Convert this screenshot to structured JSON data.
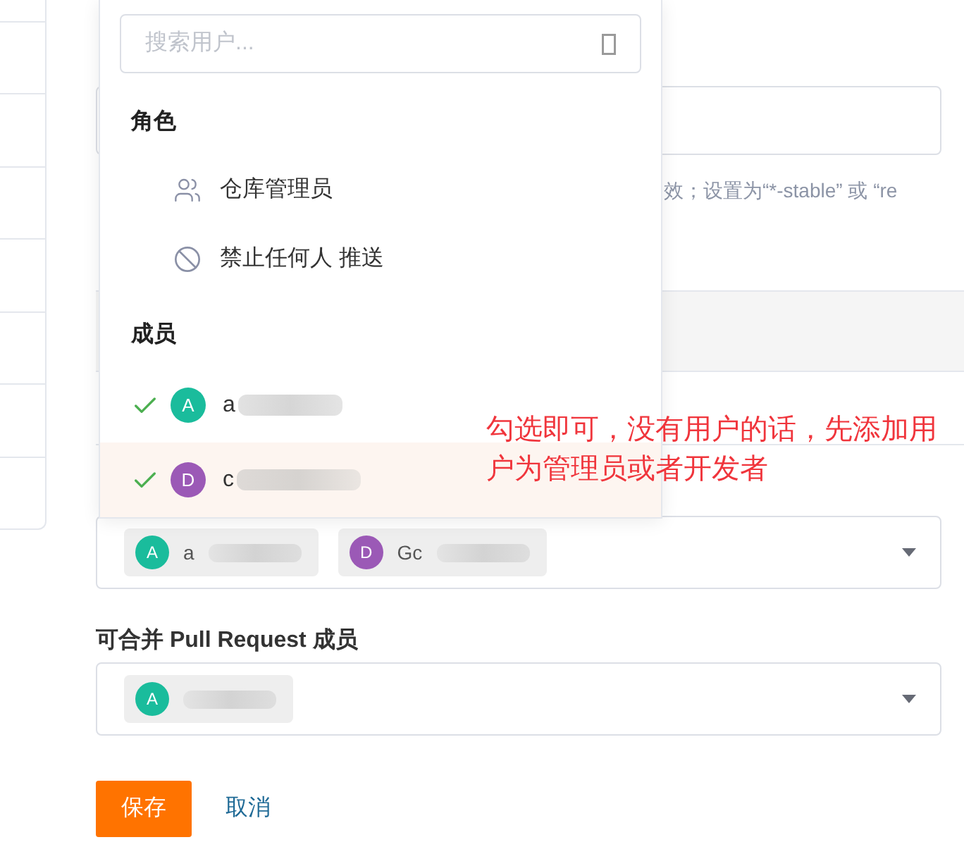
{
  "form": {
    "hint": "效；设置为“*-stable” 或 “re",
    "members_field": {
      "tags": [
        {
          "avatar": "A",
          "color": "#1abc9c",
          "name": "a"
        },
        {
          "avatar": "D",
          "color": "#9b59b6",
          "name": "Gc"
        }
      ]
    },
    "merge_field": {
      "label": "可合并 Pull Request 成员",
      "tags": [
        {
          "avatar": "A",
          "color": "#1abc9c"
        }
      ]
    },
    "buttons": [
      {
        "kind": "primary",
        "label": "保存"
      },
      {
        "kind": "link",
        "label": "取消"
      }
    ]
  },
  "dropdown": {
    "search": {
      "placeholder": "搜索用户..."
    },
    "sections": [
      {
        "title": "角色",
        "items": [
          {
            "kind": "group",
            "label": "仓库管理员"
          },
          {
            "kind": "block",
            "label": "禁止任何人 推送"
          }
        ]
      },
      {
        "title": "成员",
        "items": [
          {
            "kind": "member",
            "avatar": "A",
            "color": "#1abc9c",
            "name": "a",
            "checked": true,
            "highlighted": false
          },
          {
            "kind": "member",
            "avatar": "D",
            "color": "#9b59b6",
            "name": "c",
            "checked": true,
            "highlighted": true
          }
        ]
      }
    ]
  },
  "annotation": {
    "text": "勾选即可，没有用户的话，先添加用户为管理员或者开发者"
  }
}
